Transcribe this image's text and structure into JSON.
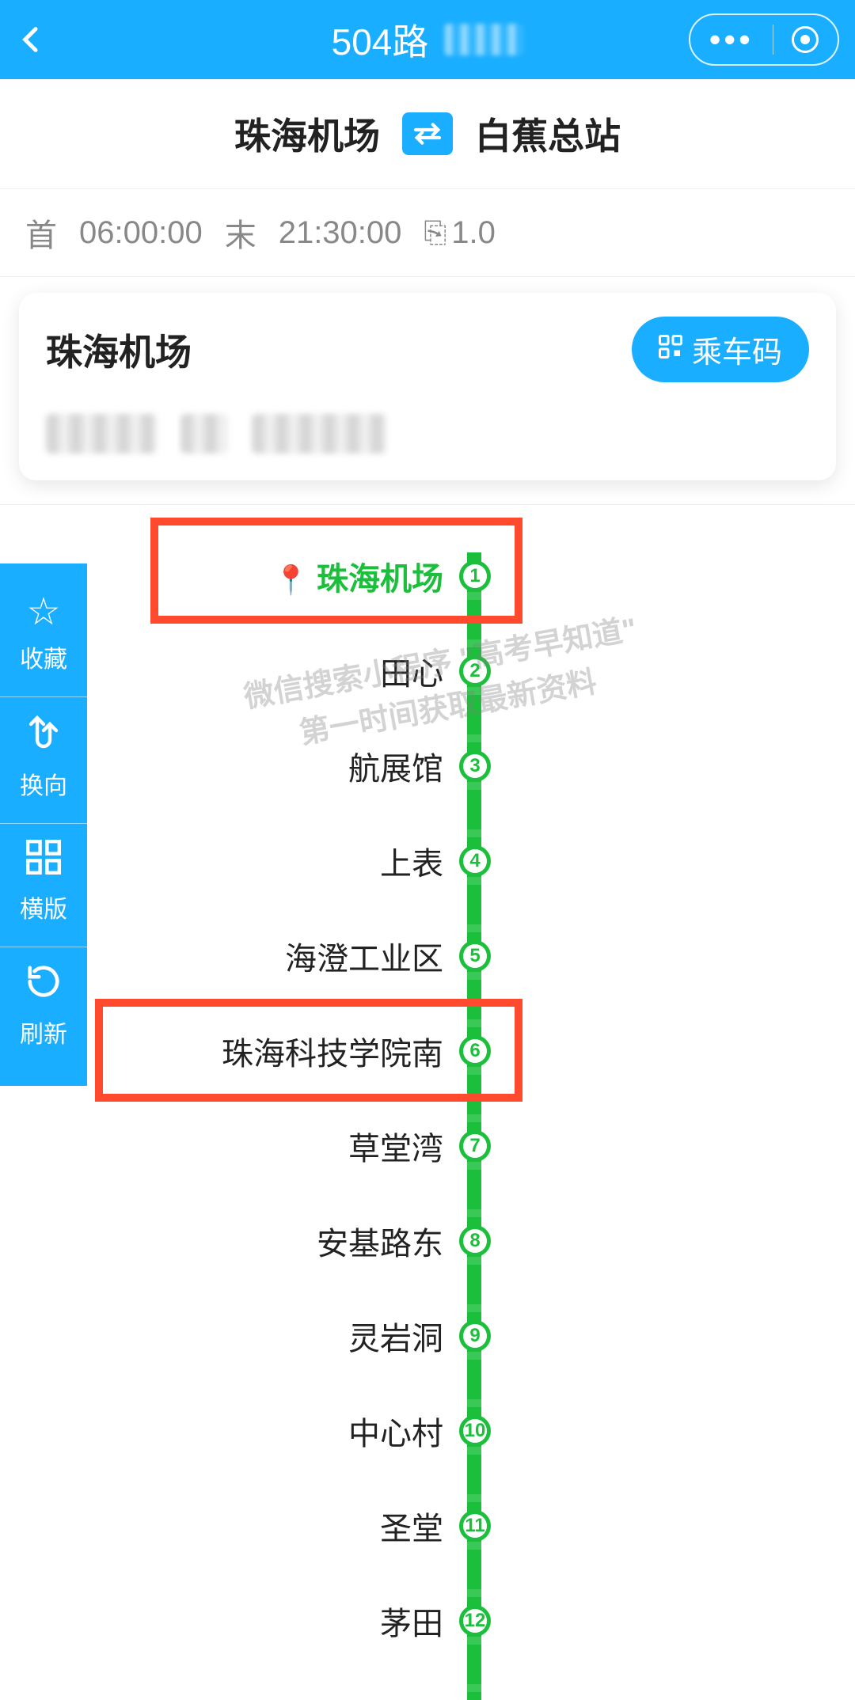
{
  "header": {
    "title": "504路"
  },
  "route": {
    "from": "珠海机场",
    "to": "白蕉总站"
  },
  "schedule": {
    "first_label": "首",
    "first_time": "06:00:00",
    "last_label": "末",
    "last_time": "21:30:00",
    "fare": "1.0"
  },
  "card": {
    "current_station": "珠海机场",
    "ride_button": "乘车码"
  },
  "stops": [
    {
      "name": "珠海机场",
      "num": "1",
      "current": true
    },
    {
      "name": "田心",
      "num": "2"
    },
    {
      "name": "航展馆",
      "num": "3"
    },
    {
      "name": "上表",
      "num": "4"
    },
    {
      "name": "海澄工业区",
      "num": "5"
    },
    {
      "name": "珠海科技学院南",
      "num": "6"
    },
    {
      "name": "草堂湾",
      "num": "7"
    },
    {
      "name": "安基路东",
      "num": "8"
    },
    {
      "name": "灵岩洞",
      "num": "9"
    },
    {
      "name": "中心村",
      "num": "10"
    },
    {
      "name": "圣堂",
      "num": "11"
    },
    {
      "name": "茅田",
      "num": "12"
    }
  ],
  "toolbar": {
    "fav": "收藏",
    "reverse": "换向",
    "layout": "横版",
    "refresh": "刷新"
  },
  "watermark": "微信搜索小程序 \"高考早知道\"\n第一时间获取最新资料"
}
